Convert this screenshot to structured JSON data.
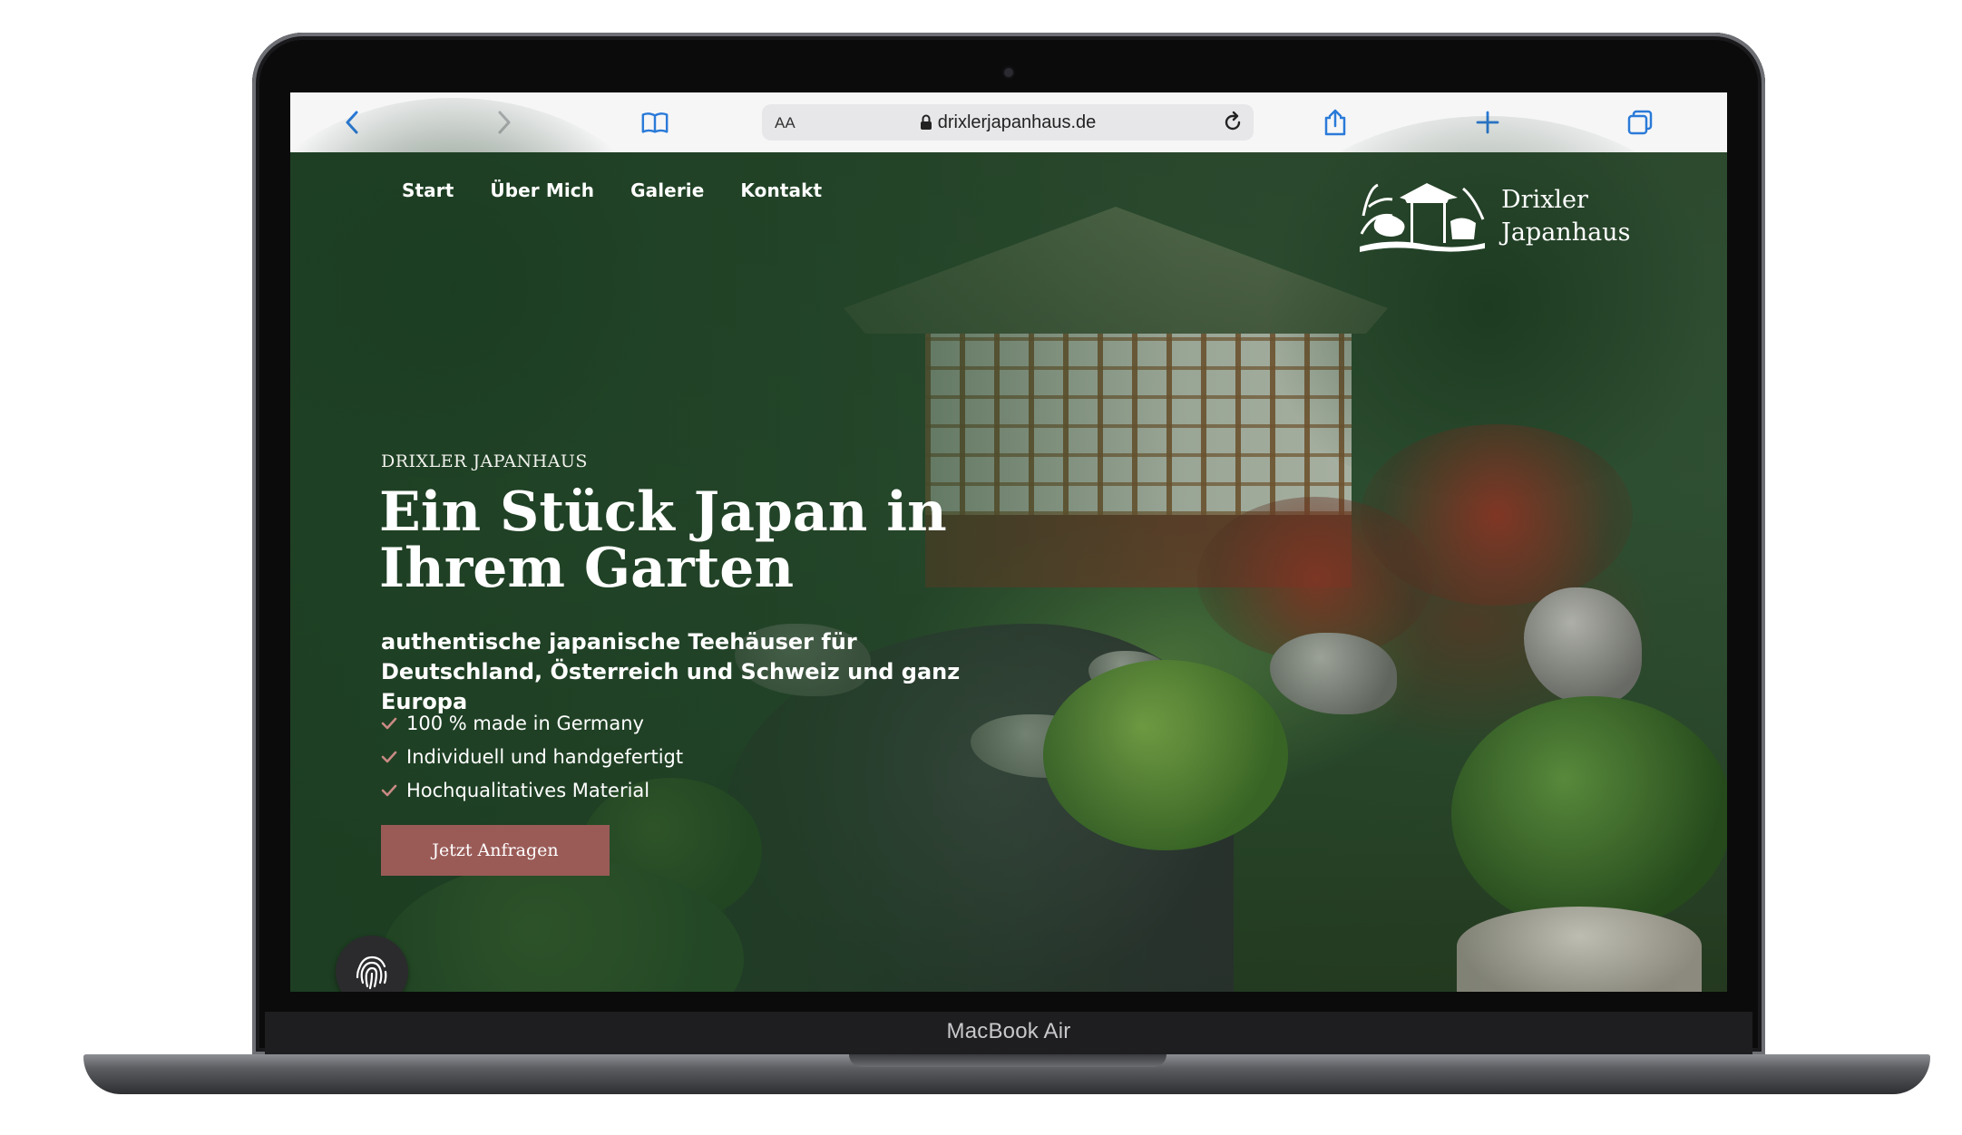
{
  "device": {
    "label": "MacBook Air"
  },
  "browser": {
    "url": "drixlerjapanhaus.de",
    "text_size_label": "AA",
    "icons": [
      "back-icon",
      "forward-icon",
      "bookmarks-icon",
      "lock-icon",
      "reload-icon",
      "share-icon",
      "new-tab-icon",
      "tabs-icon"
    ]
  },
  "nav": {
    "items": [
      {
        "label": "Start"
      },
      {
        "label": "Über Mich"
      },
      {
        "label": "Galerie"
      },
      {
        "label": "Kontakt"
      }
    ]
  },
  "logo": {
    "line1": "Drixler",
    "line2": "Japanhaus"
  },
  "hero": {
    "eyebrow": "DRIXLER JAPANHAUS",
    "headline": "Ein Stück Japan in Ihrem Garten",
    "subline": "authentische japanische Teehäuser für Deutschland, Österreich und Schweiz und ganz Europa",
    "features": [
      "100 % made in Germany",
      "Individuell und handgefertigt",
      "Hochqualitatives Material"
    ],
    "cta_label": "Jetzt Anfragen"
  },
  "colors": {
    "accent": "#9a5b57",
    "check": "#c98a84",
    "overlay_green": "#1c3e22",
    "browser_blue": "#2a7ad8"
  }
}
